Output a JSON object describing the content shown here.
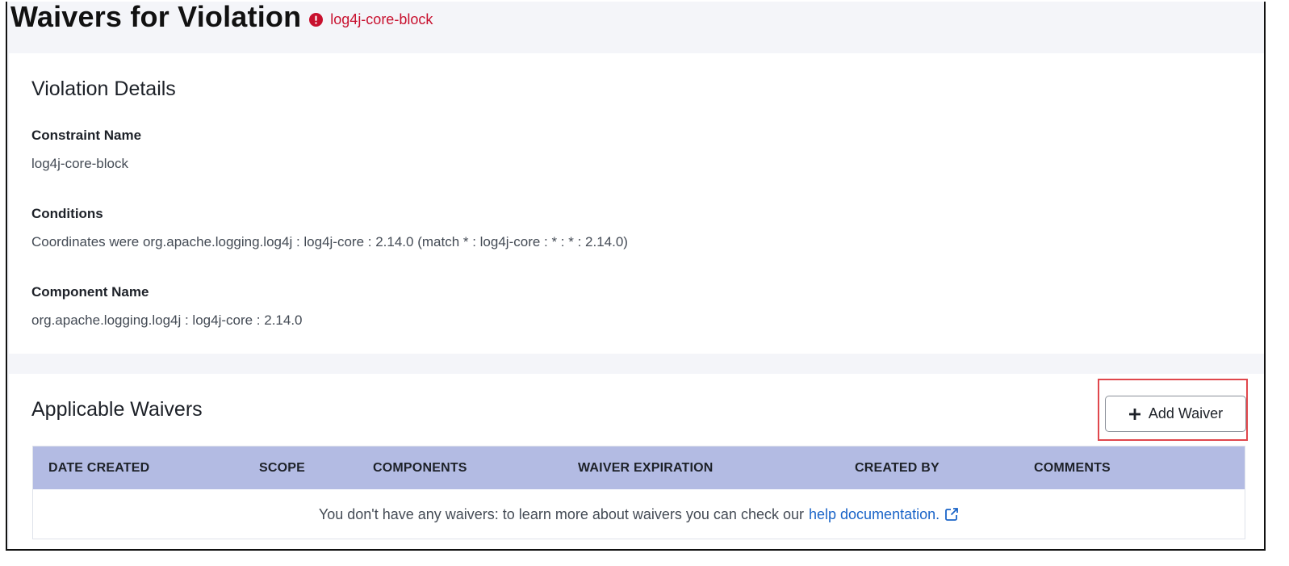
{
  "header": {
    "title": "Waivers for Violation",
    "violation_name": "log4j-core-block",
    "alert_icon": "exclamation-circle-icon",
    "alert_color": "#c8102e"
  },
  "details": {
    "title": "Violation Details",
    "fields": [
      {
        "label": "Constraint Name",
        "value": "log4j-core-block"
      },
      {
        "label": "Conditions",
        "value": "Coordinates were org.apache.logging.log4j : log4j-core : 2.14.0 (match * : log4j-core : * : * : 2.14.0)"
      },
      {
        "label": "Component Name",
        "value": "org.apache.logging.log4j : log4j-core : 2.14.0"
      }
    ]
  },
  "waivers": {
    "title": "Applicable Waivers",
    "add_button_label": "Add Waiver",
    "add_button_icon": "plus-icon",
    "columns": [
      "DATE CREATED",
      "SCOPE",
      "COMPONENTS",
      "WAIVER EXPIRATION",
      "CREATED BY",
      "COMMENTS"
    ],
    "empty_message": "You don't have any waivers: to learn more about waivers you can check our",
    "help_link_label": "help documentation.",
    "help_link_icon": "external-link-icon",
    "header_color": "#b3bbe3",
    "link_color": "#1a64c8"
  }
}
